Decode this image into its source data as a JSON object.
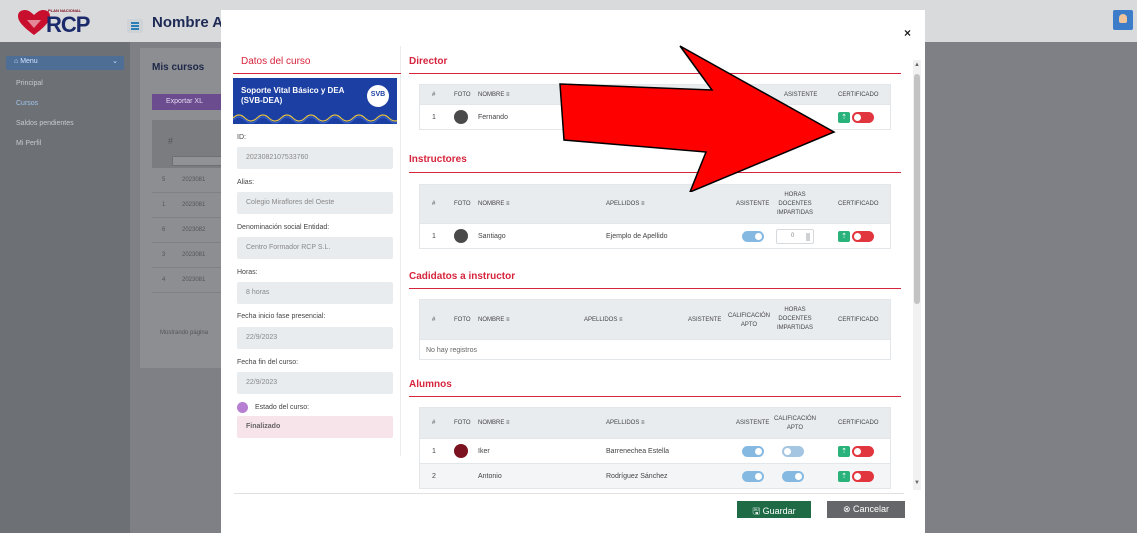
{
  "app": {
    "logo_small": "PLAN NACIONAL",
    "logo_big": "RCP",
    "page_title": "Nombre Apel"
  },
  "sidebar": {
    "menu_label": "Menu",
    "items": [
      {
        "label": "Principal"
      },
      {
        "label": "Cursos"
      },
      {
        "label": "Saldos pendientes"
      },
      {
        "label": "Mi Perfil"
      }
    ]
  },
  "background_main": {
    "title": "Mis cursos",
    "export_label": "Exportar XL",
    "hash": "#",
    "rows": [
      {
        "n": "5",
        "code": "2023081"
      },
      {
        "n": "1",
        "code": "2023081"
      },
      {
        "n": "6",
        "code": "2023082"
      },
      {
        "n": "3",
        "code": "2023081"
      },
      {
        "n": "4",
        "code": "2023081"
      }
    ],
    "paging": "Mostrando página"
  },
  "modal": {
    "close": "×",
    "left": {
      "title": "Datos del curso",
      "course_title": "Soporte Vital Básico y DEA (SVB-DEA)",
      "course_badge": "SVB",
      "fields": [
        {
          "label": "ID:",
          "value": "2023082107533760"
        },
        {
          "label": "Alias:",
          "value": "Colegio Miraflores del Oeste"
        },
        {
          "label": "Denominación social Entidad:",
          "value": "Centro Formador RCP S.L."
        },
        {
          "label": "Horas:",
          "value": "8 horas"
        },
        {
          "label": "Fecha inicio fase presencial:",
          "value": "22/9/2023"
        },
        {
          "label": "Fecha fin del curso:",
          "value": "22/9/2023"
        }
      ],
      "estado_label": "Estado del curso:",
      "estado_value": "Finalizado",
      "estado_color": "#b77fd1"
    },
    "director": {
      "title": "Director",
      "headers": {
        "hash": "#",
        "foto": "FOTO",
        "nombre": "NOMBRE ≡",
        "asistente": "ASISTENTE",
        "certificado": "CERTIFICADO"
      },
      "rows": [
        {
          "n": "1",
          "nombre": "Fernando"
        }
      ]
    },
    "instructores": {
      "title": "Instructores",
      "headers": {
        "hash": "#",
        "foto": "FOTO",
        "nombre": "NOMBRE ≡",
        "apellidos": "APELLIDOS ≡",
        "asistente": "ASISTENTE",
        "horas": "HORAS DOCENTES IMPARTIDAS",
        "certificado": "CERTIFICADO"
      },
      "rows": [
        {
          "n": "1",
          "nombre": "Santiago",
          "apellidos": "Ejemplo de Apellido",
          "horas": "0"
        }
      ]
    },
    "candidatos": {
      "title": "Cadidatos a instructor",
      "headers": {
        "hash": "#",
        "foto": "FOTO",
        "nombre": "NOMBRE ≡",
        "apellidos": "APELLIDOS ≡",
        "asistente": "ASISTENTE",
        "calificacion": "CALIFICACIÓN APTO",
        "horas": "HORAS DOCENTES IMPARTIDAS",
        "certificado": "CERTIFICADO"
      },
      "empty": "No hay registros"
    },
    "alumnos": {
      "title": "Alumnos",
      "headers": {
        "hash": "#",
        "foto": "FOTO",
        "nombre": "NOMBRE ≡",
        "apellidos": "APELLIDOS ≡",
        "asistente": "ASISTENTE",
        "calificacion": "CALIFICACIÓN APTO",
        "certificado": "CERTIFICADO"
      },
      "rows": [
        {
          "n": "1",
          "nombre": "Iker",
          "apellidos": "Barrenechea Estella"
        },
        {
          "n": "2",
          "nombre": "Antonio",
          "apellidos": "Rodríguez Sánchez"
        }
      ]
    },
    "footer": {
      "save_label": "Guardar",
      "cancel_label": "Cancelar"
    }
  },
  "colors": {
    "accent_red": "#d6243c",
    "banner_blue": "#1c3fa3",
    "save_green": "#1e6b46",
    "cancel_gray": "#646669",
    "arrow_red": "#ff0000"
  }
}
